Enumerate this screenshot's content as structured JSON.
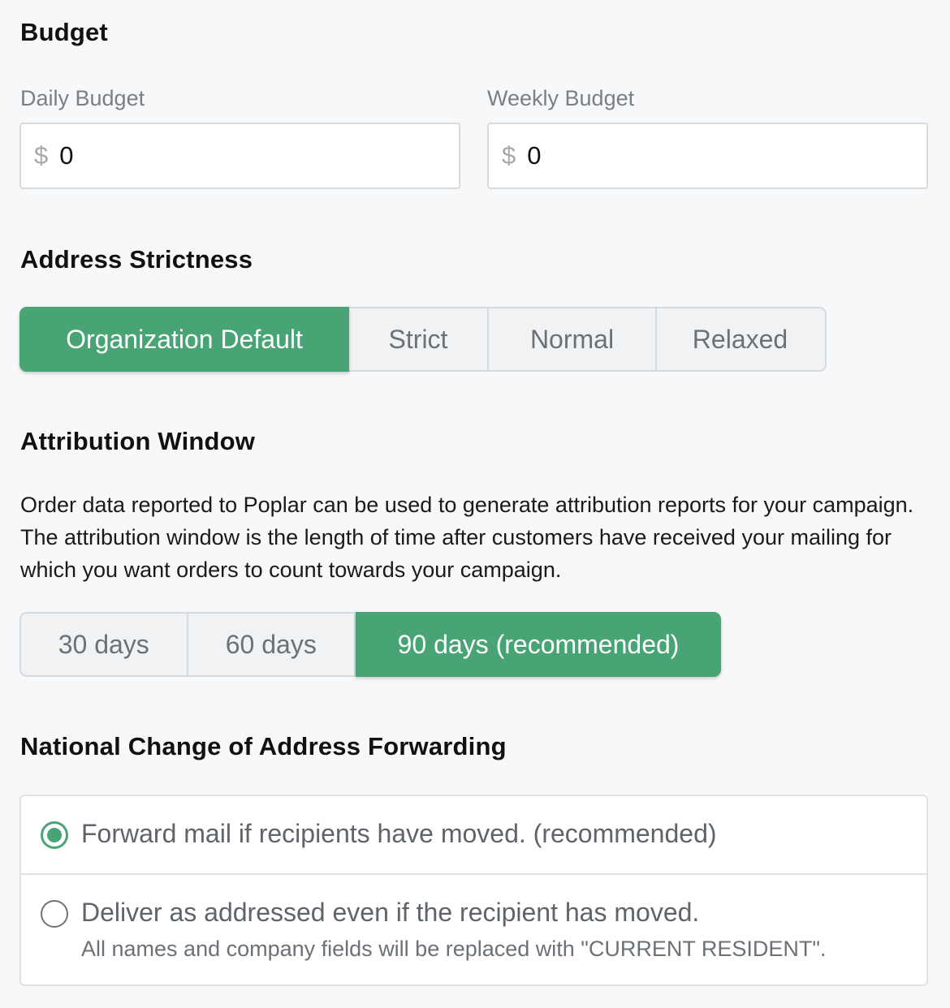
{
  "budget": {
    "title": "Budget",
    "daily": {
      "label": "Daily Budget",
      "currency": "$",
      "value": "0"
    },
    "weekly": {
      "label": "Weekly Budget",
      "currency": "$",
      "value": "0"
    }
  },
  "address_strictness": {
    "title": "Address Strictness",
    "options": [
      "Organization Default",
      "Strict",
      "Normal",
      "Relaxed"
    ],
    "selected": "Organization Default"
  },
  "attribution_window": {
    "title": "Attribution Window",
    "description": "Order data reported to Poplar can be used to generate attribution reports for your campaign. The attribution window is the length of time after customers have received your mailing for which you want orders to count towards your campaign.",
    "options": [
      "30 days",
      "60 days",
      "90 days (recommended)"
    ],
    "selected": "90 days (recommended)"
  },
  "ncoa": {
    "title": "National Change of Address Forwarding",
    "options": [
      {
        "label": "Forward mail if recipients have moved. (recommended)",
        "checked": true
      },
      {
        "label": "Deliver as addressed even if the recipient has moved.",
        "sublabel": "All names and company fields will be replaced with \"CURRENT RESIDENT\".",
        "checked": false
      }
    ]
  },
  "colors": {
    "accent": "#48a474",
    "border": "#d7dadd",
    "background": "#f7f8f9"
  }
}
